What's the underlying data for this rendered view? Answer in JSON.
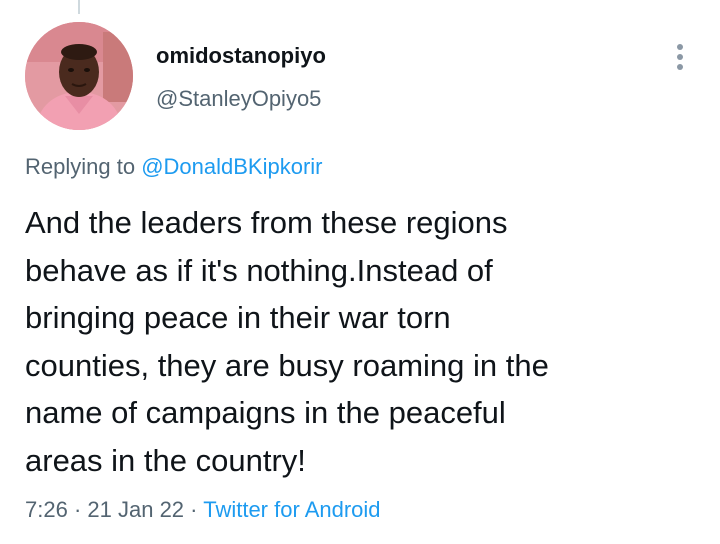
{
  "tweet": {
    "display_name": "omidostanopiyo",
    "handle": "@StanleyOpiyo5",
    "replying_prefix": "Replying to",
    "replying_to": "@DonaldBKipkorir",
    "text_lines": [
      "And the leaders from these regions",
      "behave as if it's nothing.Instead of",
      "bringing peace in their war torn",
      "counties, they are busy roaming in the",
      "name of campaigns in the peaceful",
      "areas in the country!"
    ],
    "time": "7:26",
    "date": "21 Jan 22",
    "separator": "·",
    "source": "Twitter for Android"
  },
  "colors": {
    "primary_text": "#0f1419",
    "secondary_text": "#536471",
    "link": "#1d9bf0",
    "background": "#ffffff",
    "avatar_bg": "#e7a2a8"
  },
  "icons": {
    "more": "more-vertical-icon"
  }
}
